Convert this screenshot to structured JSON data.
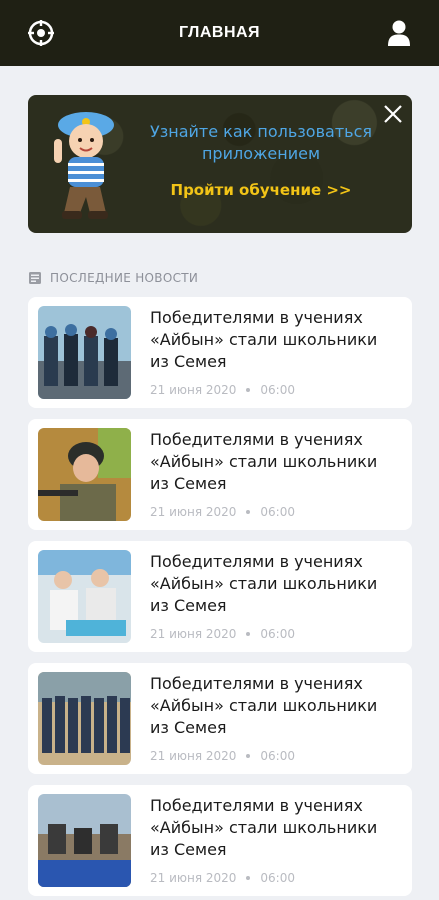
{
  "header": {
    "title": "ГЛАВНАЯ",
    "left_icon": "target-icon",
    "right_icon": "user-icon"
  },
  "banner": {
    "text": "Узнайте как пользоваться приложением",
    "link": "Пройти обучение >>",
    "text_color": "#4fa6e4",
    "link_color": "#f2c417"
  },
  "section": {
    "title": "ПОСЛЕДНИЕ НОВОСТИ",
    "icon": "newspaper-icon"
  },
  "news": [
    {
      "title": "Победителями в учениях «Айбын» стали школьники из Семея",
      "date": "21 июня 2020",
      "time": "06:00"
    },
    {
      "title": "Победителями в учениях «Айбын» стали школьники из Семея",
      "date": "21 июня 2020",
      "time": "06:00"
    },
    {
      "title": "Победителями в учениях «Айбын» стали школьники из Семея",
      "date": "21 июня 2020",
      "time": "06:00"
    },
    {
      "title": "Победителями в учениях «Айбын» стали школьники из Семея",
      "date": "21 июня 2020",
      "time": "06:00"
    },
    {
      "title": "Победителями в учениях «Айбын» стали школьники из Семея",
      "date": "21 июня 2020",
      "time": "06:00"
    }
  ]
}
